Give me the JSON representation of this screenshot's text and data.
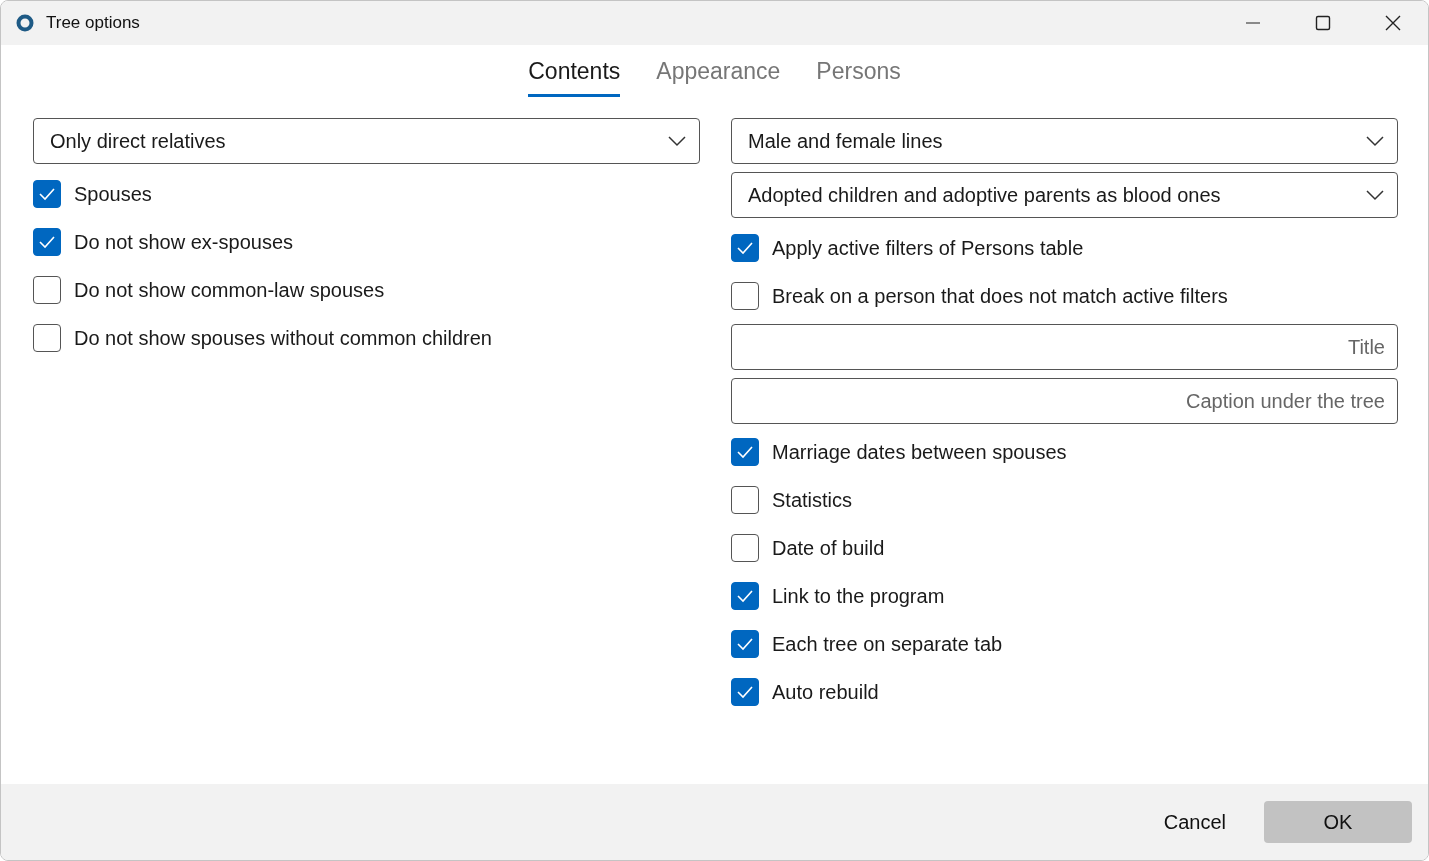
{
  "window": {
    "title": "Tree options"
  },
  "tabs": [
    {
      "label": "Contents",
      "selected": true
    },
    {
      "label": "Appearance",
      "selected": false
    },
    {
      "label": "Persons",
      "selected": false
    }
  ],
  "left_column": [
    {
      "kind": "dropdown",
      "value": "Only direct relatives"
    },
    {
      "kind": "checkbox",
      "label": "Spouses",
      "checked": true
    },
    {
      "kind": "checkbox",
      "label": "Do not show ex-spouses",
      "checked": true
    },
    {
      "kind": "checkbox",
      "label": "Do not show common-law spouses",
      "checked": false
    },
    {
      "kind": "checkbox",
      "label": "Do not show spouses without common children",
      "checked": false
    }
  ],
  "right_column": [
    {
      "kind": "dropdown",
      "value": "Male and female lines"
    },
    {
      "kind": "dropdown",
      "value": "Adopted children and adoptive parents as blood ones"
    },
    {
      "kind": "checkbox",
      "label": "Apply active filters of Persons table",
      "checked": true
    },
    {
      "kind": "checkbox",
      "label": "Break on a person that does not match active filters",
      "checked": false
    },
    {
      "kind": "field",
      "placeholder": "Title"
    },
    {
      "kind": "field",
      "placeholder": "Caption under the tree"
    },
    {
      "kind": "checkbox",
      "label": "Marriage dates between spouses",
      "checked": true
    },
    {
      "kind": "checkbox",
      "label": "Statistics",
      "checked": false
    },
    {
      "kind": "checkbox",
      "label": "Date of build",
      "checked": false
    },
    {
      "kind": "checkbox",
      "label": "Link to the program",
      "checked": true
    },
    {
      "kind": "checkbox",
      "label": "Each tree on separate tab",
      "checked": true
    },
    {
      "kind": "checkbox",
      "label": "Auto rebuild",
      "checked": true
    }
  ],
  "buttons": [
    {
      "label": "Cancel",
      "kind": "text"
    },
    {
      "label": "OK",
      "kind": "filled"
    }
  ]
}
